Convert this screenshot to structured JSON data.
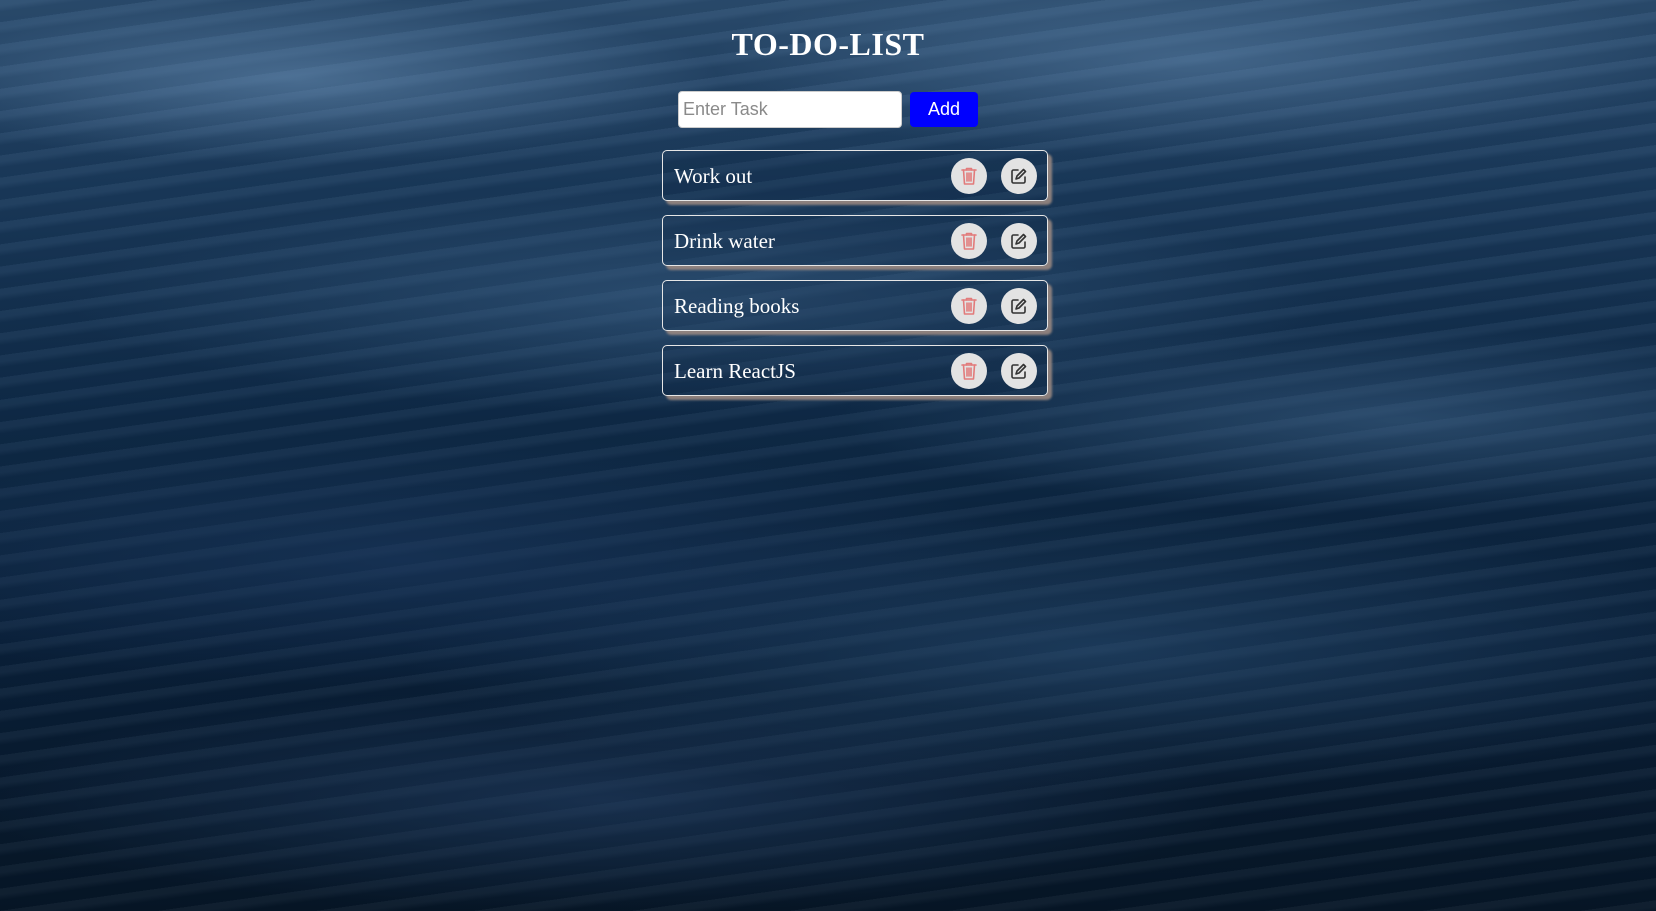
{
  "app": {
    "title": "TO-DO-LIST"
  },
  "input": {
    "placeholder": "Enter Task",
    "value": ""
  },
  "add_button": {
    "label": "Add",
    "color": "#0000ff"
  },
  "tasks": [
    {
      "text": "Work out",
      "delete_icon": "trash-icon",
      "edit_icon": "edit-icon"
    },
    {
      "text": "Drink water",
      "delete_icon": "trash-icon",
      "edit_icon": "edit-icon"
    },
    {
      "text": "Reading books",
      "delete_icon": "trash-icon",
      "edit_icon": "edit-icon"
    },
    {
      "text": "Learn ReactJS",
      "delete_icon": "trash-icon",
      "edit_icon": "edit-icon"
    }
  ],
  "colors": {
    "delete_icon": "#e27b7b",
    "edit_icon": "#333333",
    "icon_button_bg": "#e3e3e3"
  }
}
